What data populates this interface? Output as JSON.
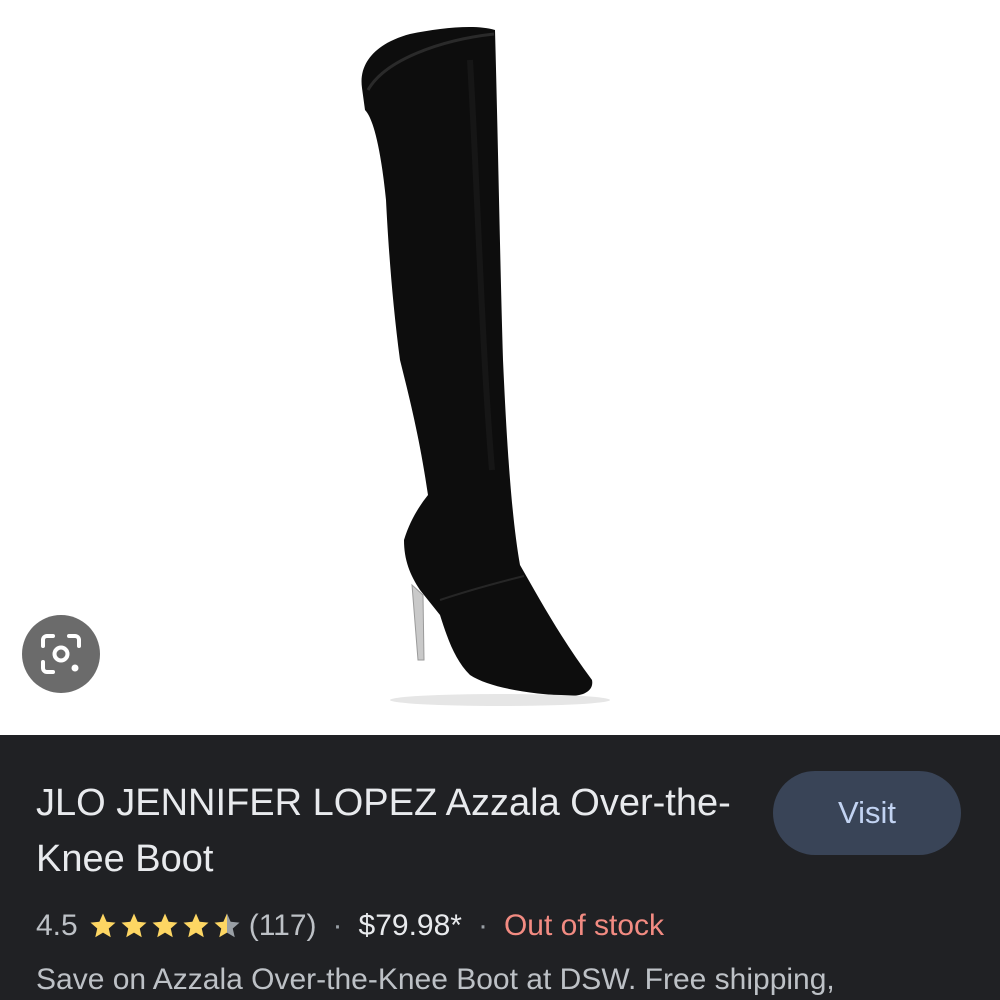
{
  "product": {
    "title": "JLO JENNIFER LOPEZ Azzala Over-the-Knee Boot",
    "visit_label": "Visit",
    "rating": "4.5",
    "rating_value": 4.5,
    "rating_max": 5,
    "review_count": "(117)",
    "separator": "·",
    "price": "$79.98*",
    "stock_status": "Out of stock",
    "snippet": "Save on Azzala Over-the-Knee Boot at DSW. Free shipping,"
  },
  "icons": {
    "lens": "google-lens-icon",
    "star": "star-icon"
  },
  "colors": {
    "panel_bg": "#202124",
    "visit_bg": "#394457",
    "visit_text": "#c2d3f2",
    "star": "#fdd663",
    "out_of_stock": "#f28b82"
  }
}
